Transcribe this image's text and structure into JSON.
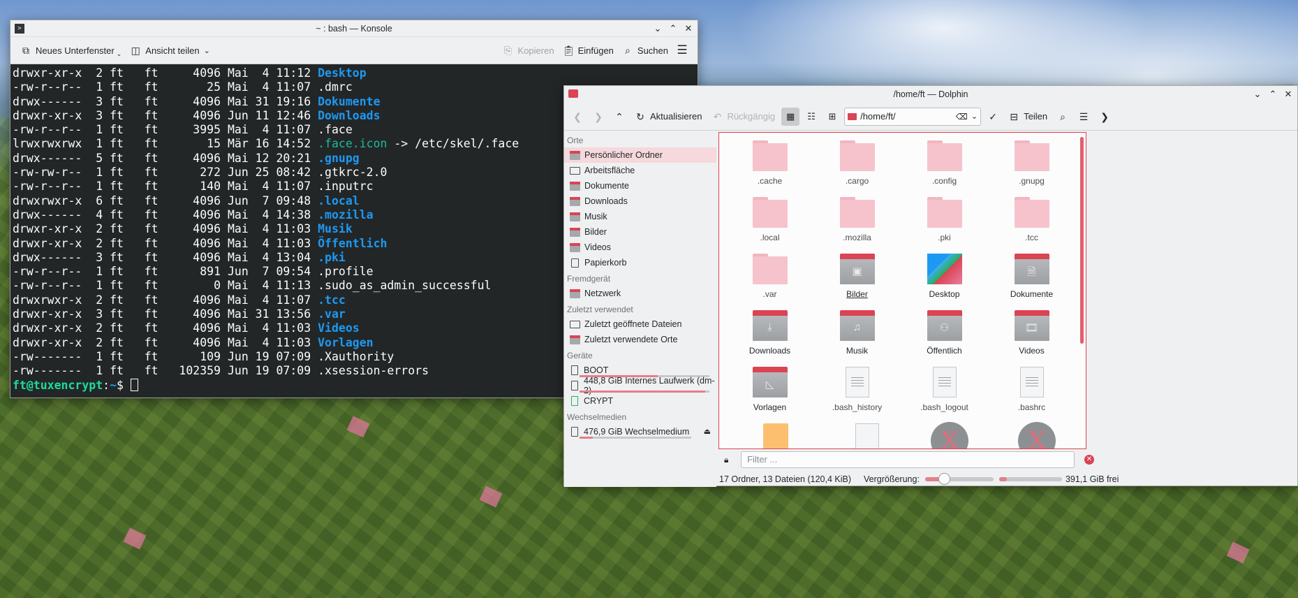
{
  "konsole": {
    "title": "~ : bash — Konsole",
    "toolbar": {
      "new_tab": "Neues Unterfenster",
      "split_view": "Ansicht teilen",
      "copy": "Kopieren",
      "paste": "Einfügen",
      "find": "Suchen"
    },
    "lines": [
      {
        "meta": "drwxr-xr-x  2 ft   ft     4096 Mai  4 11:12 ",
        "name": "Desktop",
        "kind": "dir",
        "tail": ""
      },
      {
        "meta": "-rw-r--r--  1 ft   ft       25 Mai  4 11:07 ",
        "name": ".dmrc",
        "kind": "file",
        "tail": ""
      },
      {
        "meta": "drwx------  3 ft   ft     4096 Mai 31 19:16 ",
        "name": "Dokumente",
        "kind": "dir",
        "tail": ""
      },
      {
        "meta": "drwxr-xr-x  3 ft   ft     4096 Jun 11 12:46 ",
        "name": "Downloads",
        "kind": "dir",
        "tail": ""
      },
      {
        "meta": "-rw-r--r--  1 ft   ft     3995 Mai  4 11:07 ",
        "name": ".face",
        "kind": "file",
        "tail": ""
      },
      {
        "meta": "lrwxrwxrwx  1 ft   ft       15 Mär 16 14:52 ",
        "name": ".face.icon",
        "kind": "link",
        "tail": " -> /etc/skel/.face"
      },
      {
        "meta": "drwx------  5 ft   ft     4096 Mai 12 20:21 ",
        "name": ".gnupg",
        "kind": "dir",
        "tail": ""
      },
      {
        "meta": "-rw-rw-r--  1 ft   ft      272 Jun 25 08:42 ",
        "name": ".gtkrc-2.0",
        "kind": "file",
        "tail": ""
      },
      {
        "meta": "-rw-r--r--  1 ft   ft      140 Mai  4 11:07 ",
        "name": ".inputrc",
        "kind": "file",
        "tail": ""
      },
      {
        "meta": "drwxrwxr-x  6 ft   ft     4096 Jun  7 09:48 ",
        "name": ".local",
        "kind": "dir",
        "tail": ""
      },
      {
        "meta": "drwx------  4 ft   ft     4096 Mai  4 14:38 ",
        "name": ".mozilla",
        "kind": "dir",
        "tail": ""
      },
      {
        "meta": "drwxr-xr-x  2 ft   ft     4096 Mai  4 11:03 ",
        "name": "Musik",
        "kind": "dir",
        "tail": ""
      },
      {
        "meta": "drwxr-xr-x  2 ft   ft     4096 Mai  4 11:03 ",
        "name": "Öffentlich",
        "kind": "dir",
        "tail": ""
      },
      {
        "meta": "drwx------  3 ft   ft     4096 Mai  4 13:04 ",
        "name": ".pki",
        "kind": "dir",
        "tail": ""
      },
      {
        "meta": "-rw-r--r--  1 ft   ft      891 Jun  7 09:54 ",
        "name": ".profile",
        "kind": "file",
        "tail": ""
      },
      {
        "meta": "-rw-r--r--  1 ft   ft        0 Mai  4 11:13 ",
        "name": ".sudo_as_admin_successful",
        "kind": "file",
        "tail": ""
      },
      {
        "meta": "drwxrwxr-x  2 ft   ft     4096 Mai  4 11:07 ",
        "name": ".tcc",
        "kind": "dir",
        "tail": ""
      },
      {
        "meta": "drwxr-xr-x  3 ft   ft     4096 Mai 31 13:56 ",
        "name": ".var",
        "kind": "dir",
        "tail": ""
      },
      {
        "meta": "drwxr-xr-x  2 ft   ft     4096 Mai  4 11:03 ",
        "name": "Videos",
        "kind": "dir",
        "tail": ""
      },
      {
        "meta": "drwxr-xr-x  2 ft   ft     4096 Mai  4 11:03 ",
        "name": "Vorlagen",
        "kind": "dir",
        "tail": ""
      },
      {
        "meta": "-rw-------  1 ft   ft      109 Jun 19 07:09 ",
        "name": ".Xauthority",
        "kind": "file",
        "tail": ""
      },
      {
        "meta": "-rw-------  1 ft   ft   102359 Jun 19 07:09 ",
        "name": ".xsession-errors",
        "kind": "file",
        "tail": ""
      }
    ],
    "prompt": {
      "user_host": "ft@tuxencrypt",
      "sep": ":",
      "path": "~",
      "symbol": "$ "
    }
  },
  "dolphin": {
    "title": "/home/ft — Dolphin",
    "toolbar": {
      "refresh": "Aktualisieren",
      "undo": "Rückgängig",
      "location": "/home/ft/",
      "share": "Teilen"
    },
    "places": {
      "section_places": "Orte",
      "home": "Persönlicher Ordner",
      "desktop": "Arbeitsfläche",
      "documents": "Dokumente",
      "downloads": "Downloads",
      "music": "Musik",
      "pictures": "Bilder",
      "videos": "Videos",
      "trash": "Papierkorb",
      "section_remote": "Fremdgerät",
      "network": "Netzwerk",
      "section_recent": "Zuletzt verwendet",
      "recent_files": "Zuletzt geöffnete Dateien",
      "recent_locations": "Zuletzt verwendete Orte",
      "section_devices": "Geräte",
      "boot": "BOOT",
      "internal_drive": "448,8 GiB Internes Laufwerk (dm-2)",
      "crypt": "CRYPT",
      "section_removable": "Wechselmedien",
      "removable": "476,9 GiB Wechselmedium",
      "boot_usage": 0.6,
      "internal_usage": 0.97,
      "removable_usage": 0.12
    },
    "items": [
      {
        "name": ".cache",
        "type": "folder"
      },
      {
        "name": ".cargo",
        "type": "folder"
      },
      {
        "name": ".config",
        "type": "folder"
      },
      {
        "name": ".gnupg",
        "type": "folder"
      },
      {
        "name": ".local",
        "type": "folder"
      },
      {
        "name": ".mozilla",
        "type": "folder"
      },
      {
        "name": ".pki",
        "type": "folder"
      },
      {
        "name": ".tcc",
        "type": "folder"
      },
      {
        "name": ".var",
        "type": "folder"
      },
      {
        "name": "Bilder",
        "type": "folder-pictures"
      },
      {
        "name": "Desktop",
        "type": "desktop"
      },
      {
        "name": "Dokumente",
        "type": "folder-documents"
      },
      {
        "name": "Downloads",
        "type": "folder-downloads"
      },
      {
        "name": "Musik",
        "type": "folder-music"
      },
      {
        "name": "Öffentlich",
        "type": "folder-public"
      },
      {
        "name": "Videos",
        "type": "folder-videos"
      },
      {
        "name": "Vorlagen",
        "type": "folder-templates"
      },
      {
        "name": ".bash_history",
        "type": "text-file"
      },
      {
        "name": ".bash_logout",
        "type": "text-file"
      },
      {
        "name": ".bashrc",
        "type": "text-file"
      }
    ],
    "filter_placeholder": "Filter ...",
    "status": {
      "summary": "17 Ordner, 13 Dateien (120,4 KiB)",
      "zoom_label": "Vergrößerung:",
      "zoom_level": 0.28,
      "free_space": "391,1 GiB frei",
      "used_fraction": 0.12
    },
    "colors": {
      "accent": "#da4453",
      "selection": "#f5d9dd",
      "folder_pink": "#f6c3cc"
    }
  }
}
